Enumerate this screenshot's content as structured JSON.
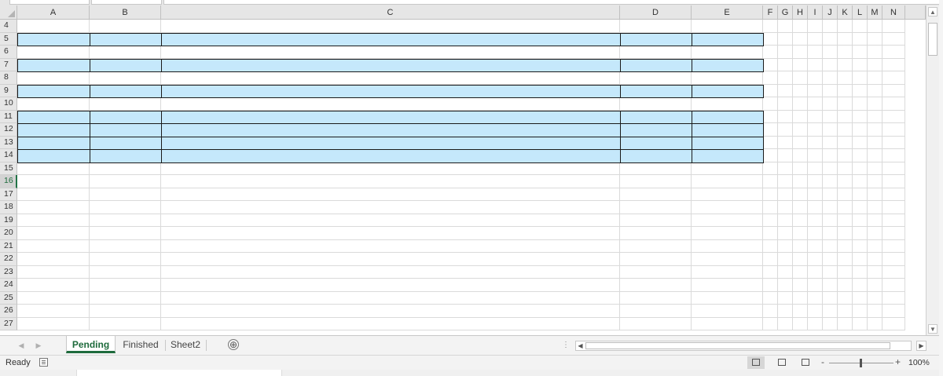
{
  "sheet": {
    "columns": [
      "A",
      "B",
      "C",
      "D",
      "E",
      "F",
      "G",
      "H",
      "I",
      "J",
      "K",
      "L",
      "M",
      "N"
    ],
    "rows": [
      4,
      5,
      6,
      7,
      8,
      9,
      10,
      11,
      12,
      13,
      14,
      15,
      16,
      17,
      18,
      19,
      20,
      21,
      22,
      23,
      24,
      25,
      26,
      27
    ],
    "active_row": 16,
    "filled_rows": [
      5,
      7,
      9,
      11,
      12,
      13,
      14
    ],
    "filled_columns": [
      "A",
      "B",
      "C",
      "D",
      "E"
    ],
    "fill_color": "#c5e8fb"
  },
  "tabs": [
    {
      "label": "Pending",
      "active": true
    },
    {
      "label": "Finished",
      "active": false
    },
    {
      "label": "Sheet2",
      "active": false
    }
  ],
  "add_sheet_label": "⊕",
  "status": {
    "ready": "Ready",
    "zoom": "100%",
    "zoom_minus": "-",
    "zoom_plus": "+"
  },
  "icons": {
    "prev_sheet": "◀",
    "next_sheet": "▶",
    "scroll_up": "▲",
    "scroll_down": "▼",
    "scroll_left": "◀",
    "scroll_right": "▶",
    "more": "⋮"
  },
  "accent_color": "#1e6b3c"
}
